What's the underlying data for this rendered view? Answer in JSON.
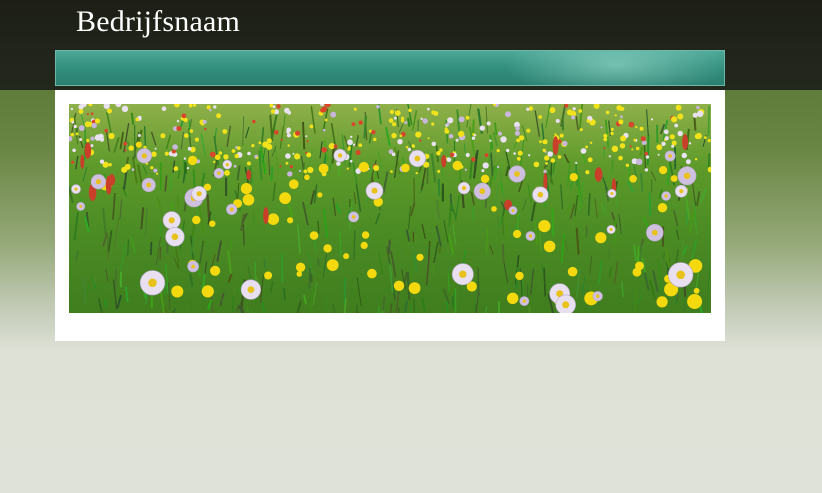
{
  "header": {
    "site_title": "Bedrijfsnaam"
  },
  "navbar": {
    "items": []
  },
  "banner": {
    "image_subject": "wildflower-meadow"
  },
  "colors": {
    "header_bg": "#1e2218",
    "navbar_accent": "#34907f",
    "page_bg_top": "#5f7c3a",
    "page_bg_bottom": "#dfe2d8",
    "panel_bg": "#ffffff"
  }
}
